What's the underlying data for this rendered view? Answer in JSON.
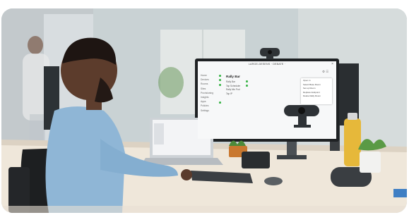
{
  "photo": {
    "subject": "man-at-desk-with-webcam",
    "colors": {
      "wall": "#c8d1d3",
      "shirt": "#8fb6d6",
      "desk": "#efe7da",
      "bottle": "#e6b83a",
      "plant": "#4f8f3c"
    }
  },
  "monitor_app": {
    "title": "LARGE-DESENS  ·  DEBATE  ·",
    "close_glyph": "×",
    "header_icons": "⚙ ☰",
    "sidebar_items": [
      "Home",
      "Devices",
      "Rooms",
      "Sites",
      "Provisioning",
      "Insights",
      "Apps",
      "Policies",
      "Settings"
    ],
    "room_name": "Rally Bar",
    "devices": [
      "Rally Bar",
      "Tap Scheduler",
      "Rally Mic Pod",
      "Tap IP"
    ],
    "menu_items": [
      "Open in",
      "Select Base Room",
      "Set up Room",
      "Replace Endpoint",
      "Delete Rally Room"
    ]
  }
}
